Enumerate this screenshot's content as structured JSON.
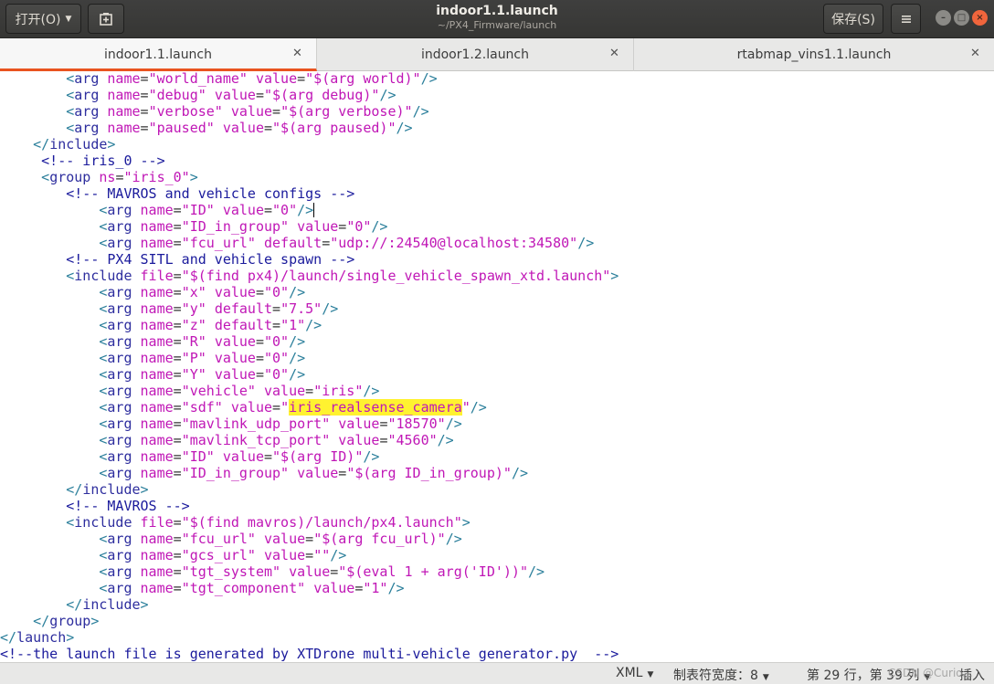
{
  "headerbar": {
    "open_label": "打开(O)",
    "save_label": "保存(S)",
    "title": "indoor1.1.launch",
    "subtitle": "~/PX4_Firmware/launch"
  },
  "tabs": [
    {
      "label": "indoor1.1.launch",
      "active": true
    },
    {
      "label": "indoor1.2.launch",
      "active": false
    },
    {
      "label": "rtabmap_vins1.1.launch",
      "active": false
    }
  ],
  "editor": {
    "lines": [
      "        <arg name=\"world_name\" value=\"$(arg world)\"/>",
      "        <arg name=\"debug\" value=\"$(arg debug)\"/>",
      "        <arg name=\"verbose\" value=\"$(arg verbose)\"/>",
      "        <arg name=\"paused\" value=\"$(arg paused)\"/>",
      "    </include>",
      "     <!-- iris_0 -->",
      "     <group ns=\"iris_0\">",
      "        <!-- MAVROS and vehicle configs -->",
      "            <arg name=\"ID\" value=\"0\"/>",
      "            <arg name=\"ID_in_group\" value=\"0\"/>",
      "            <arg name=\"fcu_url\" default=\"udp://:24540@localhost:34580\"/>",
      "        <!-- PX4 SITL and vehicle spawn -->",
      "        <include file=\"$(find px4)/launch/single_vehicle_spawn_xtd.launch\">",
      "            <arg name=\"x\" value=\"0\"/>",
      "            <arg name=\"y\" default=\"7.5\"/>",
      "            <arg name=\"z\" default=\"1\"/>",
      "            <arg name=\"R\" value=\"0\"/>",
      "            <arg name=\"P\" value=\"0\"/>",
      "            <arg name=\"Y\" value=\"0\"/>",
      "            <arg name=\"vehicle\" value=\"iris\"/>",
      "            <arg name=\"sdf\" value=\"iris_realsense_camera\"/>",
      "            <arg name=\"mavlink_udp_port\" value=\"18570\"/>",
      "            <arg name=\"mavlink_tcp_port\" value=\"4560\"/>",
      "            <arg name=\"ID\" value=\"$(arg ID)\"/>",
      "            <arg name=\"ID_in_group\" value=\"$(arg ID_in_group)\"/>",
      "        </include>",
      "        <!-- MAVROS -->",
      "        <include file=\"$(find mavros)/launch/px4.launch\">",
      "            <arg name=\"fcu_url\" value=\"$(arg fcu_url)\"/>",
      "            <arg name=\"gcs_url\" value=\"\"/>",
      "            <arg name=\"tgt_system\" value=\"$(eval 1 + arg('ID'))\"/>",
      "            <arg name=\"tgt_component\" value=\"1\"/>",
      "        </include>",
      "    </group>",
      "</launch>",
      "<!--the launch file is generated by XTDrone multi-vehicle generator.py  -->"
    ],
    "highlight_text": "iris_realsense_camera",
    "cursor_line": 8
  },
  "statusbar": {
    "language": "XML",
    "tab_width": "制表符宽度：8",
    "position": "第 29 行，第 39 列",
    "mode": "插入",
    "watermark": "CSDN @Curio..."
  },
  "colors": {
    "accent": "#e95420",
    "tag": "#2b7f9b",
    "element": "#2e2e9e",
    "attribute": "#c017b6",
    "comment": "#1a1a9c",
    "highlight": "#fff230"
  }
}
